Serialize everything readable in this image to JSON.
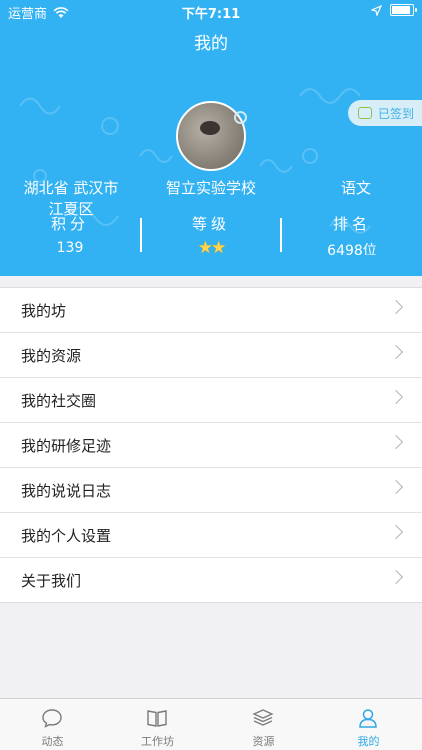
{
  "status_bar": {
    "carrier": "运营商",
    "time": "下午7:11"
  },
  "nav": {
    "title": "我的"
  },
  "profile": {
    "checkin_label": "已签到",
    "location": "湖北省 武汉市 江夏区",
    "school": "智立实验学校",
    "subject": "语文",
    "stats": [
      {
        "label": "积分",
        "value": "139"
      },
      {
        "label": "等级",
        "value": "★★"
      },
      {
        "label": "排名",
        "value": "6498位"
      }
    ]
  },
  "menu": [
    {
      "label": "我的坊"
    },
    {
      "label": "我的资源"
    },
    {
      "label": "我的社交圈"
    },
    {
      "label": "我的研修足迹"
    },
    {
      "label": "我的说说日志"
    },
    {
      "label": "我的个人设置"
    },
    {
      "label": "关于我们"
    }
  ],
  "tabs": [
    {
      "label": "动态",
      "icon": "chat-bubble-icon"
    },
    {
      "label": "工作坊",
      "icon": "book-icon"
    },
    {
      "label": "资源",
      "icon": "stack-icon"
    },
    {
      "label": "我的",
      "icon": "person-icon"
    }
  ],
  "colors": {
    "primary": "#33b2f3",
    "active_tab": "#2fa7e8"
  }
}
